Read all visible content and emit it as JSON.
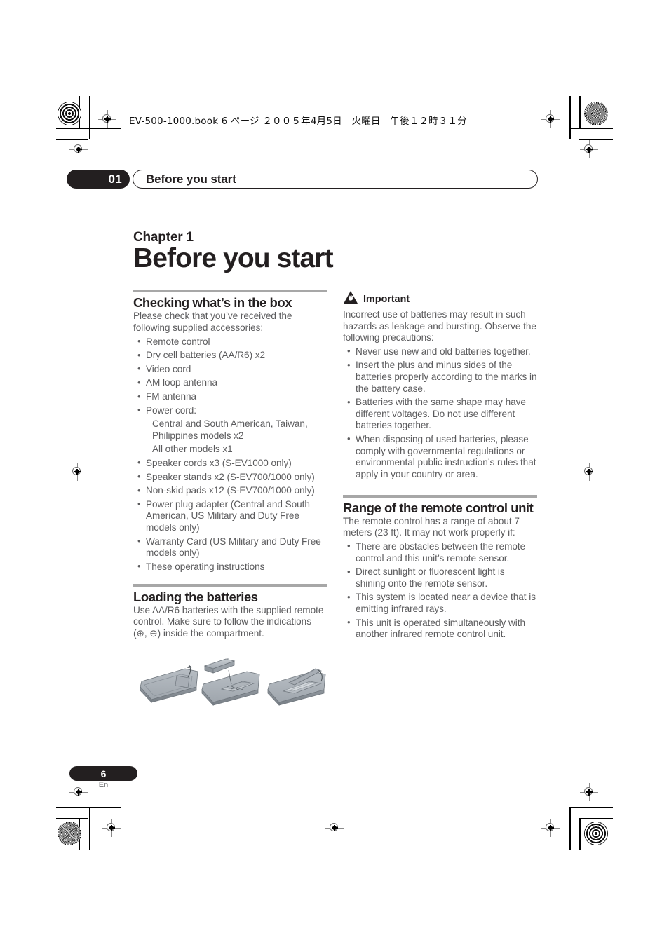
{
  "print_marks": {
    "book_line": "EV-500-1000.book 6 ページ ２００５年4月5日　火曜日　午後１２時３１分"
  },
  "running_head": {
    "chapter_number": "01",
    "title": "Before you start"
  },
  "chapter": {
    "label": "Chapter 1",
    "title": "Before you start"
  },
  "left_column": {
    "section_box": {
      "heading": "Checking what’s in the box",
      "intro": "Please check that you’ve received the following supplied accessories:",
      "items": [
        {
          "text": "Remote control",
          "bullet": true
        },
        {
          "text": "Dry cell batteries (AA/R6) x2",
          "bullet": true
        },
        {
          "text": "Video cord",
          "bullet": true
        },
        {
          "text": "AM loop antenna",
          "bullet": true
        },
        {
          "text": "FM antenna",
          "bullet": true
        },
        {
          "text": "Power cord:",
          "bullet": true
        },
        {
          "text": "Central and South American, Taiwan, Philippines models x2",
          "bullet": false
        },
        {
          "text": "All other models x1",
          "bullet": false
        },
        {
          "text": "Speaker cords x3 (S-EV1000 only)",
          "bullet": true
        },
        {
          "text": "Speaker stands x2 (S-EV700/1000 only)",
          "bullet": true
        },
        {
          "text": "Non-skid pads x12 (S-EV700/1000 only)",
          "bullet": true
        },
        {
          "text": "Power plug adapter (Central and South American, US Military and Duty Free models only)",
          "bullet": true
        },
        {
          "text": "Warranty Card (US Military and Duty Free models only)",
          "bullet": true
        },
        {
          "text": "These operating instructions",
          "bullet": true
        }
      ]
    },
    "section_batteries": {
      "heading": "Loading the batteries",
      "body_before": "Use AA/R6 batteries with the supplied remote control. Make sure to follow the indications (",
      "plus_symbol": "⊕",
      "body_middle": ", ",
      "minus_symbol": "⊖",
      "body_after": ") inside the compartment."
    }
  },
  "right_column": {
    "important": {
      "icon": "warning-triangle-hand-icon",
      "label": "Important",
      "intro": "Incorrect use of batteries may result in such hazards as leakage and bursting. Observe the following precautions:",
      "items": [
        "Never use new and old batteries together.",
        "Insert the plus and minus sides of the batteries properly according to the marks in the battery case.",
        "Batteries with the same shape may have different voltages. Do not use different batteries together.",
        "When disposing of used batteries, please comply with governmental regulations or environmental public instruction’s rules that apply in your country or area."
      ]
    },
    "section_range": {
      "heading": "Range of the remote control unit",
      "intro": "The remote control has a range of about 7 meters (23 ft). It may not work properly if:",
      "items": [
        "There are obstacles between the remote control and this unit’s remote sensor.",
        "Direct sunlight or fluorescent light is shining onto the remote sensor.",
        "This system is located near a device that is emitting infrared rays.",
        "This unit is operated simultaneously with another infrared remote control unit."
      ]
    }
  },
  "illustration": {
    "name": "remote-control-battery-loading-steps",
    "step_count": 3
  },
  "footer": {
    "page_number": "6",
    "language": "En"
  },
  "colors": {
    "ink": "#231f20",
    "body_text": "#5b5b5d",
    "rule": "#a7a7a7",
    "illustration_grey": "#9aa0a6"
  }
}
